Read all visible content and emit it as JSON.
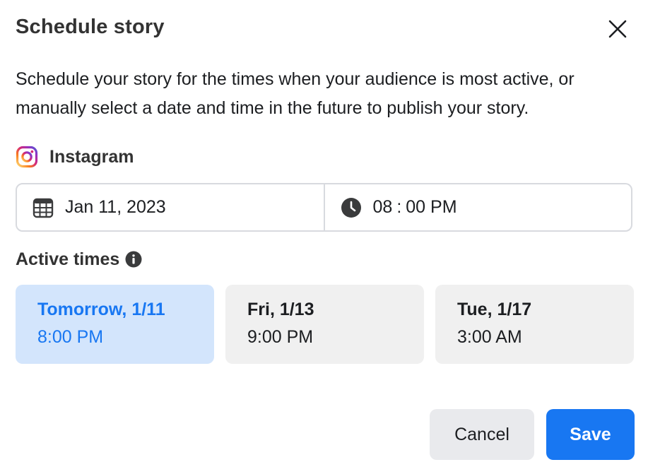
{
  "dialog": {
    "title": "Schedule story",
    "close_icon": "close-icon",
    "description": "Schedule your story for the times when your audience is most active, or manually select a date and time in the future to publish your story."
  },
  "platform": {
    "icon": "instagram-icon",
    "label": "Instagram"
  },
  "schedule": {
    "date_icon": "calendar-icon",
    "date": "Jan 11, 2023",
    "time_icon": "clock-icon",
    "hour": "08",
    "separator": ":",
    "minute": "00",
    "meridiem": "PM"
  },
  "active_times": {
    "label": "Active times",
    "info_icon": "info-icon",
    "slots": [
      {
        "day": "Tomorrow, 1/11",
        "time": "8:00 PM",
        "selected": true
      },
      {
        "day": "Fri, 1/13",
        "time": "9:00 PM",
        "selected": false
      },
      {
        "day": "Tue, 1/17",
        "time": "3:00 AM",
        "selected": false
      }
    ]
  },
  "actions": {
    "cancel_label": "Cancel",
    "save_label": "Save"
  },
  "colors": {
    "primary": "#1877f2",
    "selected_bg": "#d3e5fc",
    "slot_bg": "#f0f0f0",
    "border": "#d8dadf"
  }
}
